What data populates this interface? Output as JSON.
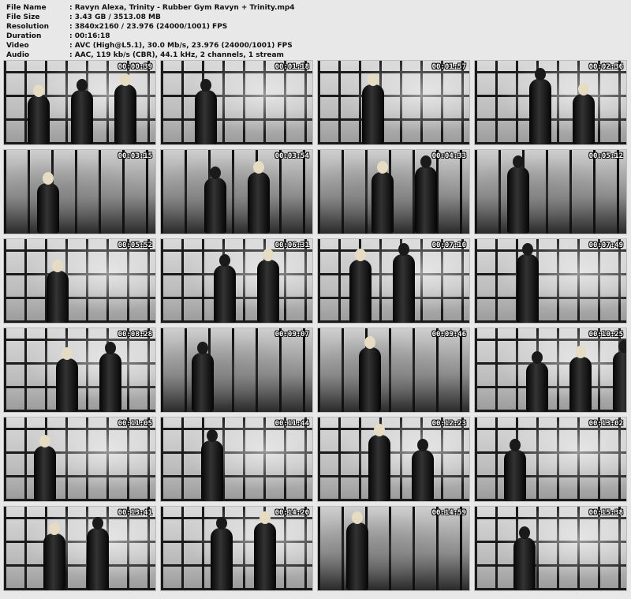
{
  "info": [
    {
      "key": "File Name",
      "value": ":  Ravyn Alexa, Trinity - Rubber Gym Ravyn + Trinity.mp4"
    },
    {
      "key": "File Size",
      "value": ":  3.43 GB  / 3513.08 MB"
    },
    {
      "key": "Resolution",
      "value": ":  3840x2160 / 23.976 (24000/1001) FPS"
    },
    {
      "key": "Duration",
      "value": ":  00:16:18"
    },
    {
      "key": "Video",
      "value": ":  AVC (High@L5.1), 30.0 Mb/s, 23.976 (24000/1001) FPS"
    },
    {
      "key": "Audio",
      "value": ":  AAC, 119 kb/s (CBR), 44.1 kHz, 2 channels, 1 stream"
    }
  ],
  "thumbnails": [
    {
      "time": "00:00:39"
    },
    {
      "time": "00:01:18"
    },
    {
      "time": "00:01:57"
    },
    {
      "time": "00:02:36"
    },
    {
      "time": "00:03:15"
    },
    {
      "time": "00:03:54"
    },
    {
      "time": "00:04:33"
    },
    {
      "time": "00:05:12"
    },
    {
      "time": "00:05:52"
    },
    {
      "time": "00:06:31"
    },
    {
      "time": "00:07:10"
    },
    {
      "time": "00:07:49"
    },
    {
      "time": "00:08:28"
    },
    {
      "time": "00:09:07"
    },
    {
      "time": "00:09:46"
    },
    {
      "time": "00:10:25"
    },
    {
      "time": "00:11:05"
    },
    {
      "time": "00:11:44"
    },
    {
      "time": "00:12:23"
    },
    {
      "time": "00:13:02"
    },
    {
      "time": "00:13:41"
    },
    {
      "time": "00:14:20"
    },
    {
      "time": "00:14:59"
    },
    {
      "time": "00:15:38"
    }
  ]
}
